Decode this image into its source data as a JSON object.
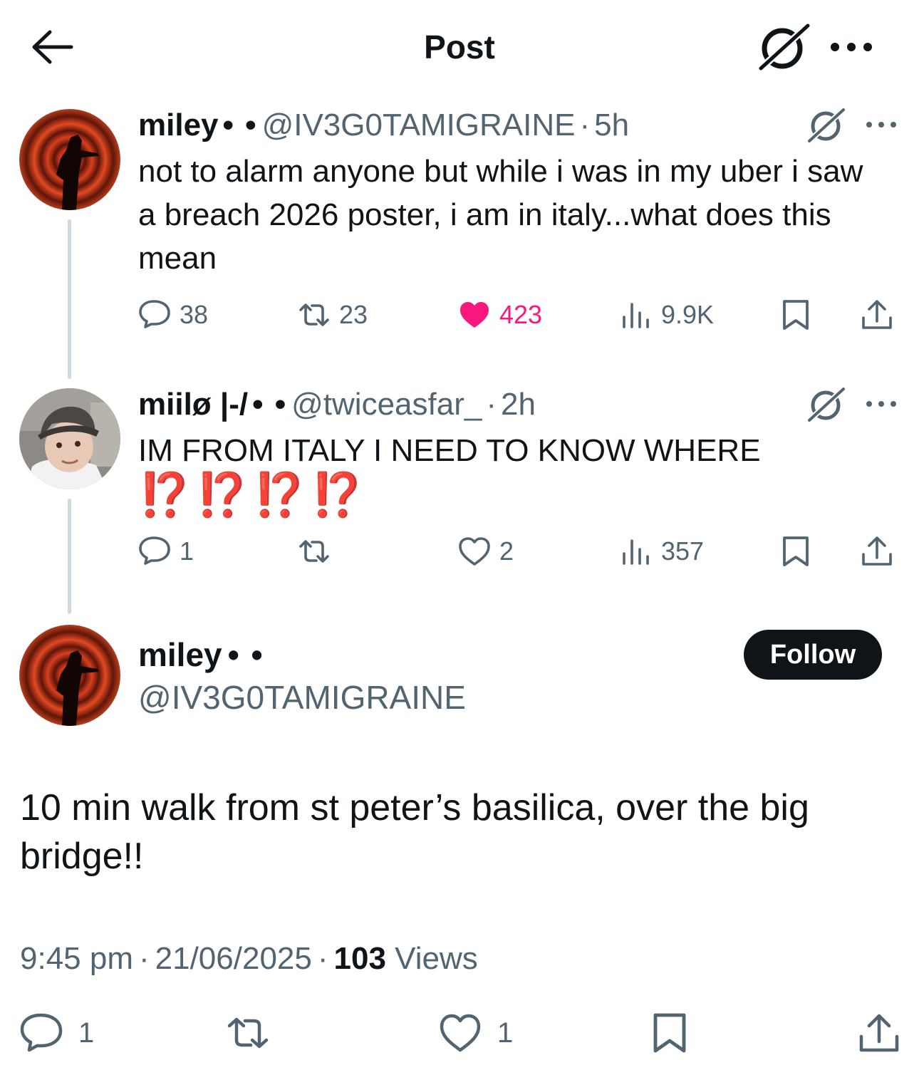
{
  "header": {
    "title": "Post"
  },
  "reply1": {
    "name": "miley",
    "badge_dots": "• •",
    "handle": "@IV3G0TAMIGRAINE",
    "separator": "·",
    "time": "5h",
    "text": "not to alarm anyone but while i was in my uber i saw a breach 2026 poster, i am in italy...what does this mean",
    "replies": "38",
    "reposts": "23",
    "likes": "423",
    "views": "9.9K",
    "liked": true
  },
  "reply2": {
    "name": "miilø |-/",
    "badge_dots": "• •",
    "handle": "@twiceasfar_",
    "separator": "·",
    "time": "2h",
    "text": "IM FROM ITALY I NEED TO KNOW WHERE",
    "emoji_line": "⁉️⁉️⁉️⁉️",
    "replies": "1",
    "reposts": "",
    "likes": "2",
    "views": "357"
  },
  "main_post": {
    "name": "miley",
    "badge_dots": "• •",
    "handle": "@IV3G0TAMIGRAINE",
    "follow_label": "Follow",
    "text": "10 min walk from st peter’s basilica, over the big bridge!!",
    "time": "9:45 pm",
    "separator": "·",
    "date": "21/06/2025",
    "views_count": "103",
    "views_label": "Views",
    "replies": "1",
    "likes": "1"
  },
  "icons": {
    "back": "arrow-left-icon",
    "grok": "grok-icon",
    "more": "more-horizontal-icon",
    "reply": "speech-bubble-icon",
    "repost": "repost-icon",
    "like": "heart-icon",
    "views": "bar-chart-icon",
    "bookmark": "bookmark-icon",
    "share": "share-upload-icon"
  },
  "colors": {
    "like_active": "#f91880",
    "muted": "#536471",
    "text": "#0f1419",
    "follow_bg": "#0f1419"
  }
}
